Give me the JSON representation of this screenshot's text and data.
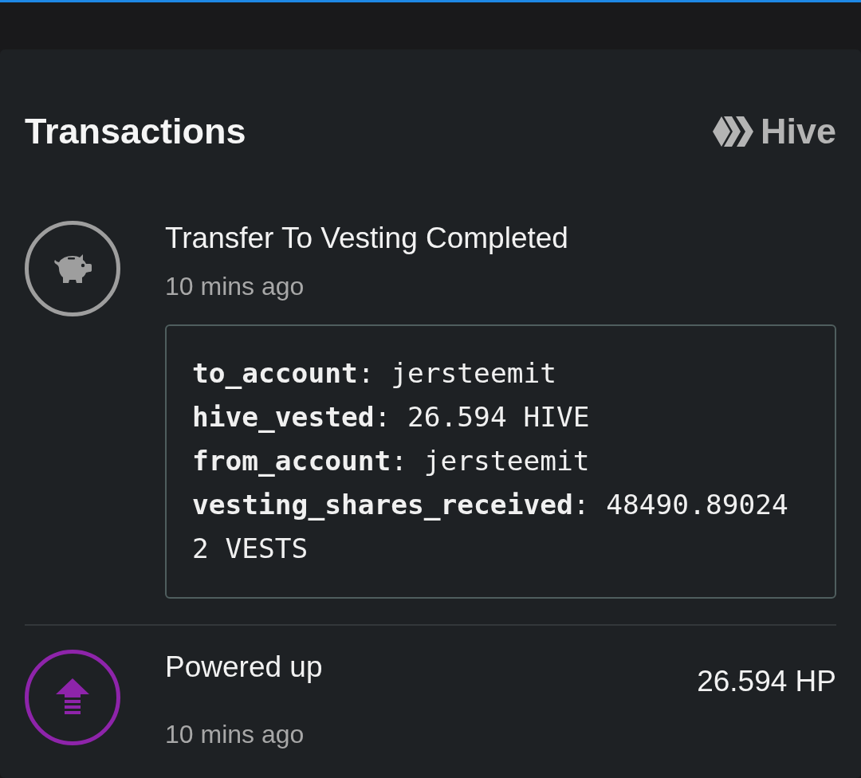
{
  "header": {
    "title": "Transactions",
    "network": "Hive"
  },
  "transactions": [
    {
      "kind": "vesting",
      "color": "#9e9e9e",
      "title": "Transfer To Vesting Completed",
      "time": "10 mins ago",
      "details": [
        "**to_account**: jersteemit",
        "**hive_vested**: 26.594 HIVE",
        "**from_account**: jersteemit",
        "**vesting_shares_received**: 48490.890242 VESTS"
      ]
    },
    {
      "kind": "power_up",
      "color": "#8e24aa",
      "title": "Powered up",
      "time": "10 mins ago",
      "amount": "26.594 HP"
    }
  ]
}
